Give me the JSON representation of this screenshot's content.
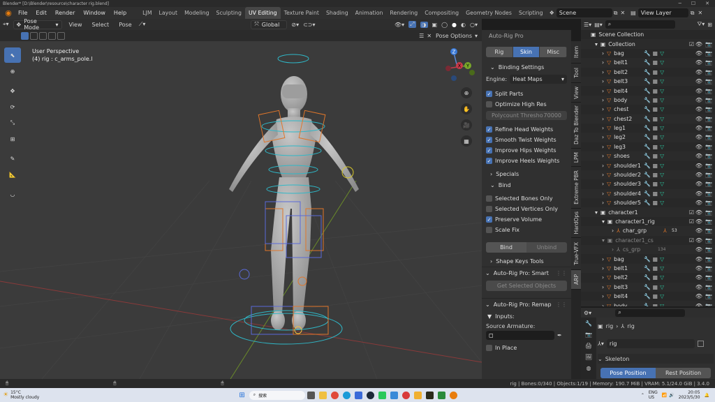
{
  "titlebar": {
    "title": "Blender* [D:\\Blender\\resource\\character rig.blend]"
  },
  "menubar": {
    "menus": [
      "File",
      "Edit",
      "Render",
      "Window",
      "Help"
    ],
    "workspaces": [
      "LJM",
      "Layout",
      "Modeling",
      "Sculpting",
      "UV Editing",
      "Texture Paint",
      "Shading",
      "Animation",
      "Rendering",
      "Compositing",
      "Geometry Nodes",
      "Scripting"
    ],
    "active_workspace": "UV Editing",
    "scene": "Scene",
    "view_layer": "View Layer"
  },
  "viewport_header": {
    "mode": "Pose Mode",
    "menus": [
      "View",
      "Select",
      "Pose"
    ],
    "orientation": "Global",
    "pose_options": "Pose Options"
  },
  "viewport": {
    "view_name": "User Perspective",
    "active_info": "(4) rig : c_arms_pole.l",
    "axes": [
      "Z",
      "Y",
      "X"
    ]
  },
  "npanel": {
    "section_title": "Auto-Rig Pro",
    "tabs": [
      "Rig",
      "Skin",
      "Misc"
    ],
    "active_tab": "Skin",
    "binding_settings": "Binding Settings",
    "engine_label": "Engine:",
    "engine_value": "Heat Maps",
    "options1": [
      {
        "label": "Split Parts",
        "checked": true
      },
      {
        "label": "Optimize High Res",
        "checked": false
      }
    ],
    "polycount_label": "Polycount Thresho",
    "polycount_value": "70000",
    "options2": [
      {
        "label": "Refine Head Weights",
        "checked": true
      },
      {
        "label": "Smooth Twist Weights",
        "checked": true
      },
      {
        "label": "Improve Hips Weights",
        "checked": true
      },
      {
        "label": "Improve Heels Weights",
        "checked": true
      }
    ],
    "specials": "Specials",
    "bind": "Bind",
    "options3": [
      {
        "label": "Selected Bones Only",
        "checked": false
      },
      {
        "label": "Selected Vertices Only",
        "checked": false
      },
      {
        "label": "Preserve Volume",
        "checked": true
      },
      {
        "label": "Scale Fix",
        "checked": false
      }
    ],
    "bind_button": "Bind",
    "unbind_button": "Unbind",
    "shape_keys": "Shape Keys Tools",
    "smart_title": "Auto-Rig Pro: Smart",
    "get_selected": "Get Selected Objects",
    "remap_title": "Auto-Rig Pro: Remap",
    "inputs": "Inputs:",
    "source_armature": "Source Armature:",
    "in_place": "In Place"
  },
  "vertical_tabs": [
    "Item",
    "Tool",
    "View",
    "Daz To Blender",
    "LPM",
    "Extreme PBR",
    "HardOps",
    "True-VFX",
    "ARP"
  ],
  "outliner": {
    "root": "Scene Collection",
    "collection": "Collection",
    "items_a": [
      "bag",
      "belt1",
      "belt2",
      "belt3",
      "belt4",
      "body",
      "chest",
      "chest2",
      "leg1",
      "leg2",
      "leg3",
      "shoes",
      "shoulder1",
      "shoulder2",
      "shoulder3",
      "shoulder4",
      "shoulder5"
    ],
    "character_collection": "character1",
    "rig_collection": "character1_rig",
    "char_grp": "char_grp",
    "char_grp_count": "53",
    "cs_collection": "character1_cs",
    "cs_grp": "cs_grp",
    "cs_grp_count": "134",
    "items_b": [
      "bag",
      "belt1",
      "belt2",
      "belt3",
      "belt4",
      "body"
    ]
  },
  "properties": {
    "breadcrumb_a": "rig",
    "breadcrumb_b": "rig",
    "object_name": "rig",
    "skeleton": "Skeleton",
    "pose_position": "Pose Position",
    "rest_position": "Rest Position"
  },
  "statusbar": {
    "stats": "rig | Bones:0/340 | Objects:1/19 | Memory: 190.7 MiB | VRAM: 5.1/24.0 GiB | 3.4.0"
  },
  "taskbar": {
    "weather_temp": "15°C",
    "weather_desc": "Mostly cloudy",
    "search": "搜索",
    "lang1": "ENG",
    "lang2": "US",
    "time": "20:05",
    "date": "2023/5/30"
  },
  "colors": {
    "accent": "#4772b3",
    "bg": "#303030",
    "viewport": "#3b3b3b"
  }
}
